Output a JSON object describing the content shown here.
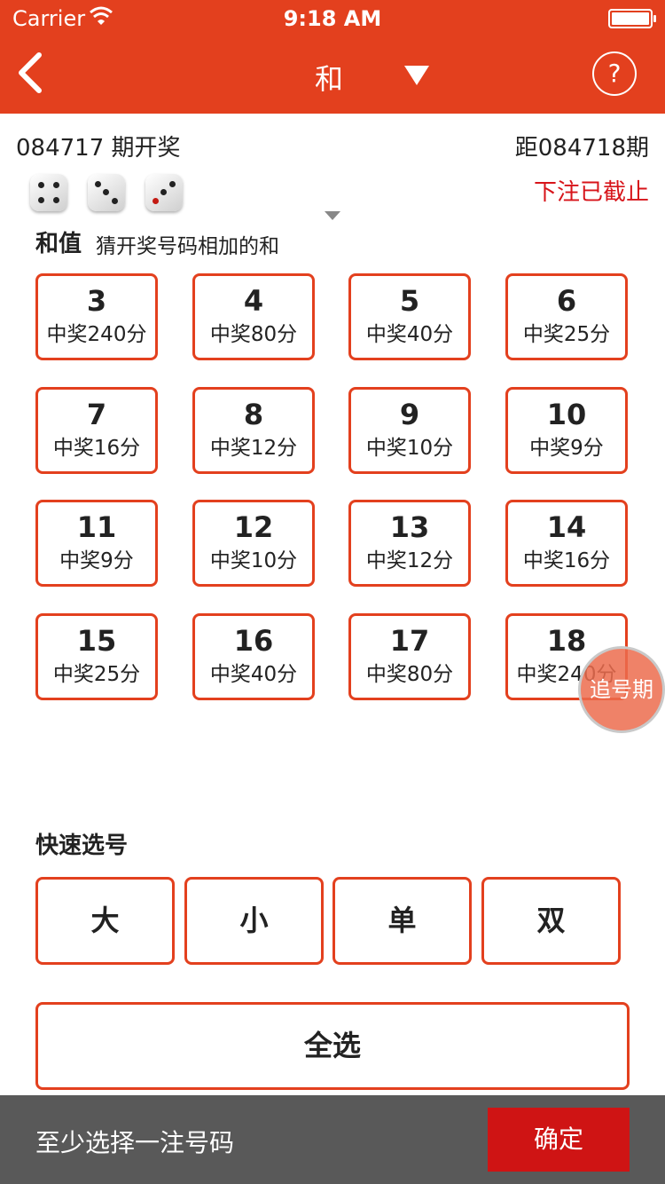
{
  "status_bar": {
    "carrier": "Carrier",
    "time": "9:18 AM"
  },
  "nav": {
    "title": "和",
    "help_label": "?"
  },
  "draw": {
    "current_period": "084717 期开奖",
    "next_period_label": "距084718期",
    "closed_text": "下注已截止",
    "dice_values": [
      4,
      3,
      3
    ]
  },
  "play": {
    "title": "和值",
    "description": "猜开奖号码相加的和"
  },
  "numbers": [
    {
      "n": "3",
      "prize": "中奖240分"
    },
    {
      "n": "4",
      "prize": "中奖80分"
    },
    {
      "n": "5",
      "prize": "中奖40分"
    },
    {
      "n": "6",
      "prize": "中奖25分"
    },
    {
      "n": "7",
      "prize": "中奖16分"
    },
    {
      "n": "8",
      "prize": "中奖12分"
    },
    {
      "n": "9",
      "prize": "中奖10分"
    },
    {
      "n": "10",
      "prize": "中奖9分"
    },
    {
      "n": "11",
      "prize": "中奖9分"
    },
    {
      "n": "12",
      "prize": "中奖10分"
    },
    {
      "n": "13",
      "prize": "中奖12分"
    },
    {
      "n": "14",
      "prize": "中奖16分"
    },
    {
      "n": "15",
      "prize": "中奖25分"
    },
    {
      "n": "16",
      "prize": "中奖40分"
    },
    {
      "n": "17",
      "prize": "中奖80分"
    },
    {
      "n": "18",
      "prize": "中奖240分"
    }
  ],
  "chase_label": "追号期",
  "quick": {
    "title": "快速选号",
    "options": [
      "大",
      "小",
      "单",
      "双"
    ],
    "select_all": "全选"
  },
  "bottom": {
    "hint": "至少选择一注号码",
    "confirm": "确定"
  },
  "colors": {
    "brand": "#e3401e",
    "confirm": "#cf1414",
    "bottom_bar": "#595959",
    "closed_text": "#d7141a"
  }
}
